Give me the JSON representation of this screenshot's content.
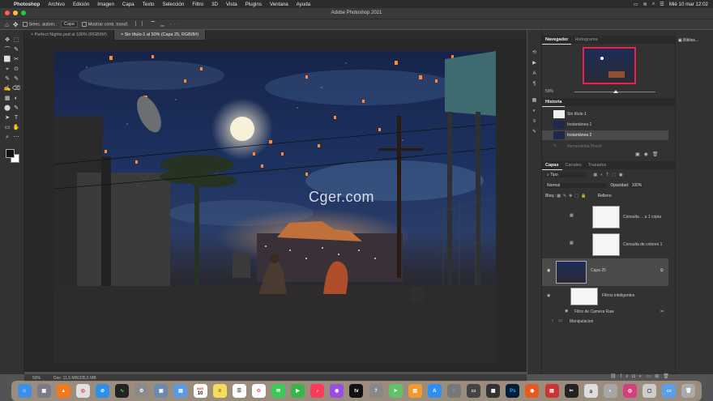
{
  "menubar": {
    "app_name": "Photoshop",
    "items": [
      "Archivo",
      "Edición",
      "Imagen",
      "Capa",
      "Texto",
      "Selección",
      "Filtro",
      "3D",
      "Vista",
      "Plugins",
      "Ventana",
      "Ayuda"
    ],
    "clock": "Mié 10 mar  12:02"
  },
  "window": {
    "title": "Adobe Photoshop 2021"
  },
  "options_bar": {
    "auto_select_label": "Selec. autom.:",
    "auto_select_value": "Capa",
    "transform_label": "Mostrar contr. transf."
  },
  "doc_tabs": [
    {
      "label": "Perfect Nights.psd al 100% (RGB/8#)"
    },
    {
      "label": "Sin título-1 al 50% (Capa 25, RGB/8#)"
    }
  ],
  "navigator": {
    "tabs": [
      "Navegador",
      "Histograma"
    ],
    "zoom": "50%"
  },
  "history": {
    "title": "Historia",
    "items": [
      "Sin título-1",
      "Instantánea 1",
      "Instantánea 2",
      "Herramienta Pincel"
    ]
  },
  "layers": {
    "tabs": [
      "Capas",
      "Canales",
      "Trazados"
    ],
    "filter_kind": "Tipo",
    "blend_mode": "Normal",
    "opacity_label": "Opacidad:",
    "opacity_value": "100%",
    "lock_label": "Bloq.:",
    "fill_label": "Relleno",
    "rows": [
      {
        "name": "Consulta ... a 1 copia"
      },
      {
        "name": "Consulta de colores 1"
      },
      {
        "name": "Capa 25"
      },
      {
        "name": "Filtros inteligentes"
      },
      {
        "name": "Filtro de Camera Raw"
      },
      {
        "name": "Manipulacion"
      }
    ]
  },
  "libraries": {
    "label": "Biblios..."
  },
  "status": {
    "zoom": "50%",
    "doc": "Doc: 11,5 MB/335,5 MB"
  },
  "watermark": {
    "text": "Cger.com"
  },
  "dock": {
    "calendar_day": "10",
    "calendar_month": "MAR"
  },
  "colors": {
    "accent": "#4a8df8",
    "panel": "#323232",
    "canvas_bg": "#282828"
  }
}
